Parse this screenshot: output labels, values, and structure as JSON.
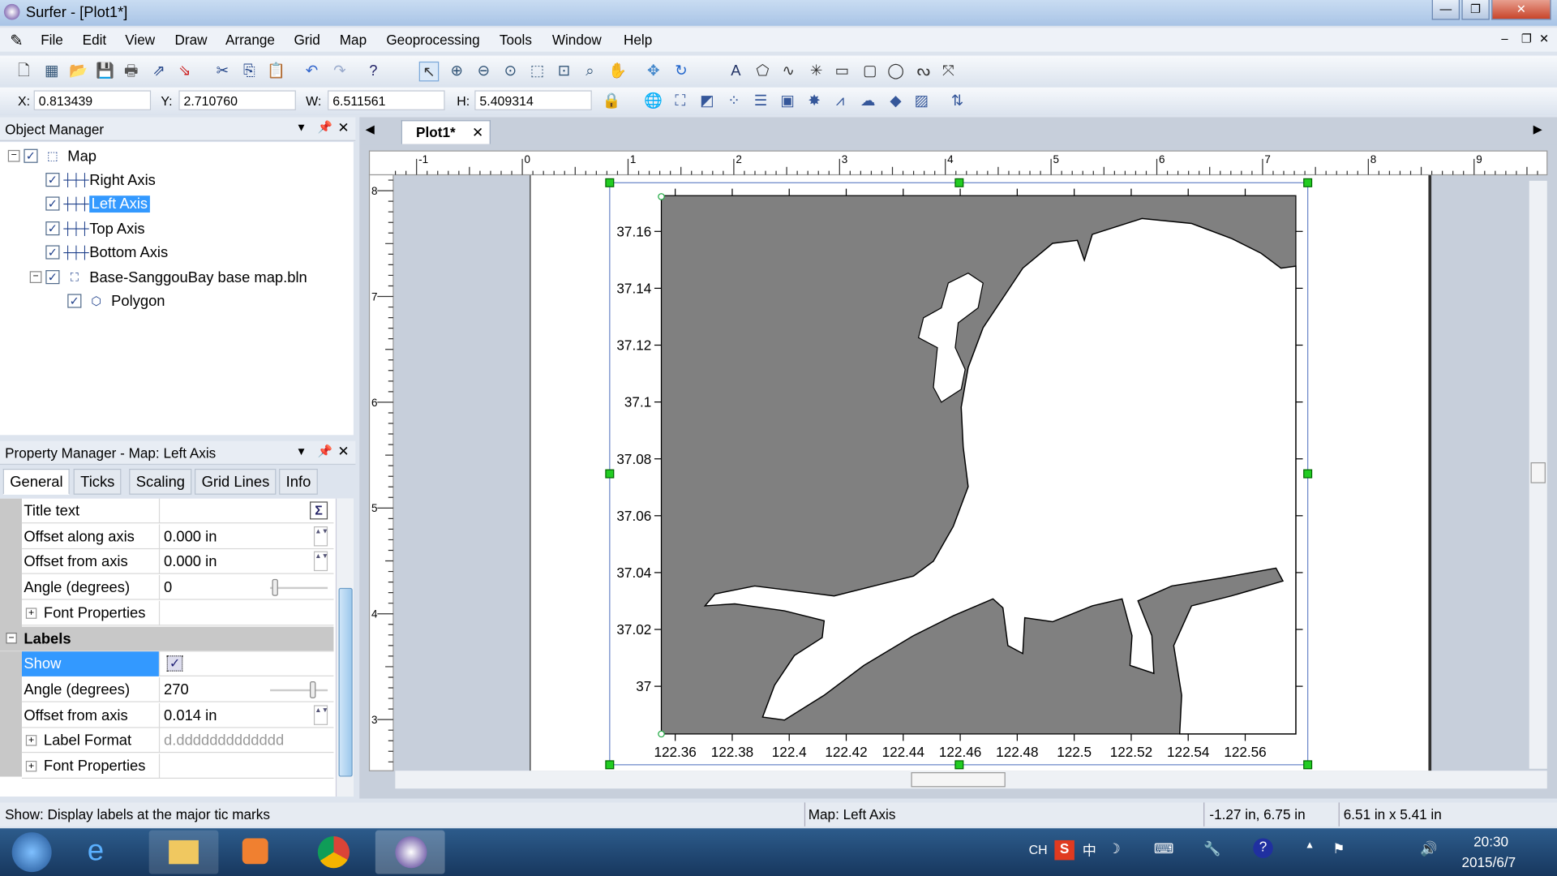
{
  "window": {
    "title": "Surfer - [Plot1*]",
    "min": "—",
    "max": "❐",
    "close": "✕"
  },
  "menu": [
    "File",
    "Edit",
    "View",
    "Draw",
    "Arrange",
    "Grid",
    "Map",
    "Geoprocessing",
    "Tools",
    "Window",
    "Help"
  ],
  "coords": {
    "x_label": "X:",
    "x": "0.813439",
    "y_label": "Y:",
    "y": "2.710760",
    "w_label": "W:",
    "w": "6.511561",
    "h_label": "H:",
    "h": "5.409314"
  },
  "object_manager": {
    "title": "Object Manager",
    "items": [
      {
        "label": "Map",
        "checked": true,
        "icon": "map-frame-icon"
      },
      {
        "label": "Right Axis",
        "checked": true,
        "icon": "axis-icon"
      },
      {
        "label": "Left Axis",
        "checked": true,
        "icon": "axis-icon",
        "selected": true
      },
      {
        "label": "Top Axis",
        "checked": true,
        "icon": "axis-icon"
      },
      {
        "label": "Bottom Axis",
        "checked": true,
        "icon": "axis-icon"
      },
      {
        "label": "Base-SanggouBay base map.bln",
        "checked": true,
        "icon": "base-map-icon"
      },
      {
        "label": "Polygon",
        "checked": true,
        "icon": "polygon-icon"
      }
    ]
  },
  "property_manager": {
    "title": "Property Manager - Map: Left Axis",
    "tabs": [
      "General",
      "Ticks",
      "Scaling",
      "Grid Lines",
      "Info"
    ],
    "active_tab": "General",
    "rows": [
      {
        "k": "Title text",
        "v": ""
      },
      {
        "k": "Offset along axis",
        "v": "0.000 in"
      },
      {
        "k": "Offset from axis",
        "v": "0.000 in"
      },
      {
        "k": "Angle (degrees)",
        "v": "0"
      },
      {
        "k": "Font Properties",
        "v": ""
      },
      {
        "k": "Labels",
        "v": ""
      },
      {
        "k": "Show",
        "v": ""
      },
      {
        "k": "Angle (degrees)",
        "v": "270"
      },
      {
        "k": "Offset from axis",
        "v": "0.014 in"
      },
      {
        "k": "Label Format",
        "v": "d.ddddddddddddd"
      },
      {
        "k": "Font Properties",
        "v": ""
      }
    ],
    "show_checked": true
  },
  "doc_tab": {
    "label": "Plot1*"
  },
  "rulers": {
    "h": [
      "-1",
      "0",
      "1",
      "2",
      "3",
      "4",
      "5",
      "6",
      "7",
      "8",
      "9"
    ],
    "v": [
      "8",
      "7",
      "6",
      "5",
      "4",
      "3"
    ]
  },
  "chart_data": {
    "type": "map",
    "x_ticks": [
      "122.36",
      "122.38",
      "122.4",
      "122.42",
      "122.44",
      "122.46",
      "122.48",
      "122.5",
      "122.52",
      "122.54",
      "122.56"
    ],
    "y_ticks": [
      "37.16",
      "37.14",
      "37.12",
      "37.1",
      "37.08",
      "37.06",
      "37.04",
      "37.02",
      "37"
    ],
    "land_color": "#808080",
    "water_color": "#ffffff"
  },
  "status": {
    "hint": "Show: Display labels at the major tic marks",
    "selection": "Map: Left Axis",
    "position": "-1.27 in, 6.75 in",
    "size": "6.51 in x 5.41 in"
  },
  "taskbar": {
    "lang": "CH",
    "time": "20:30",
    "date": "2015/6/7"
  }
}
